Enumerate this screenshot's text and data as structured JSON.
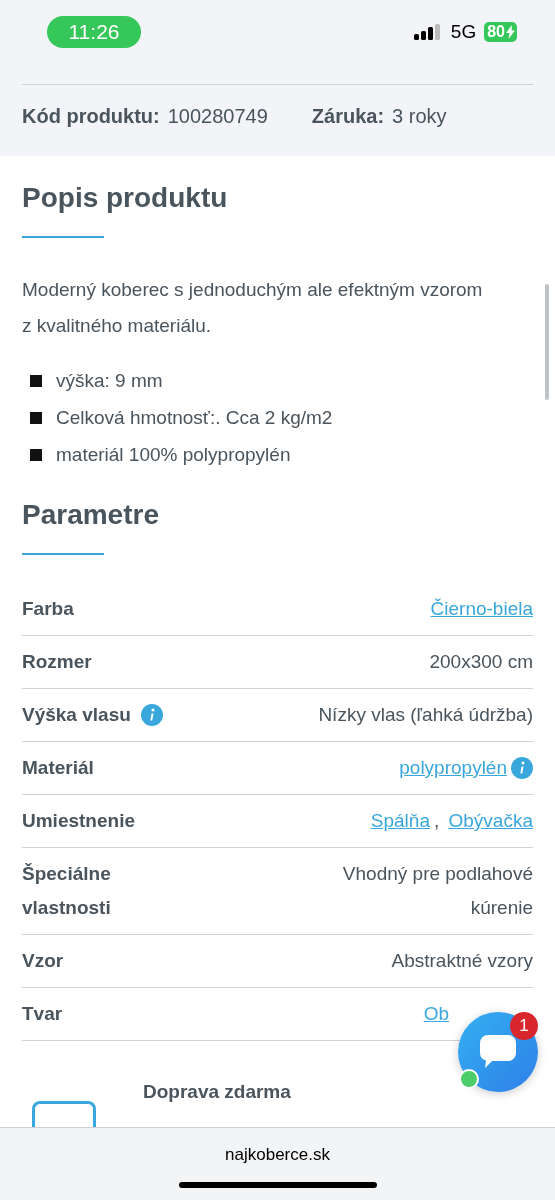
{
  "status_bar": {
    "time": "11:26",
    "network": "5G",
    "battery": "80"
  },
  "product_info": [
    {
      "label": "Kód produktu:",
      "value": "100280749"
    },
    {
      "label": "Záruka:",
      "value": "3 roky"
    }
  ],
  "description": {
    "title": "Popis produktu",
    "text": "Moderný koberec s jednoduchým ale efektným vzorom z kvalitného materiálu.",
    "bullets": [
      "výška: 9 mm",
      "Celková hmotnosť:. Cca 2 kg/m2",
      "materiál 100% polypropylén"
    ]
  },
  "parameters": {
    "title": "Parametre",
    "rows": [
      {
        "label": "Farba",
        "label_info": false,
        "value": [
          {
            "text": "Čierno-biela",
            "link": true
          }
        ],
        "value_info": false
      },
      {
        "label": "Rozmer",
        "label_info": false,
        "value": [
          {
            "text": "200x300 cm",
            "link": false
          }
        ],
        "value_info": false
      },
      {
        "label": "Výška vlasu",
        "label_info": true,
        "value": [
          {
            "text": "Nízky vlas (ľahká údržba)",
            "link": false
          }
        ],
        "value_info": false
      },
      {
        "label": "Materiál",
        "label_info": false,
        "value": [
          {
            "text": "polypropylén",
            "link": true
          }
        ],
        "value_info": true
      },
      {
        "label": "Umiestnenie",
        "label_info": false,
        "value": [
          {
            "text": "Spálňa",
            "link": true
          },
          {
            "text": ", ",
            "link": false
          },
          {
            "text": "Obývačka",
            "link": true
          }
        ],
        "value_info": false
      },
      {
        "label": "Špeciálne vlastnosti",
        "label_info": false,
        "value": [
          {
            "text": "Vhodný pre podlahové kúrenie",
            "link": false
          }
        ],
        "value_info": false
      },
      {
        "label": "Vzor",
        "label_info": false,
        "value": [
          {
            "text": "Abstraktné vzory",
            "link": false
          }
        ],
        "value_info": false
      },
      {
        "label": "Tvar",
        "label_info": false,
        "value": [
          {
            "text": "Ob",
            "link": true
          }
        ],
        "value_info": false
      }
    ]
  },
  "benefit": {
    "title": "Doprava zdarma"
  },
  "chat": {
    "badge": "1",
    "online": true
  },
  "browser_bar": {
    "url": "najkoberce.sk"
  }
}
